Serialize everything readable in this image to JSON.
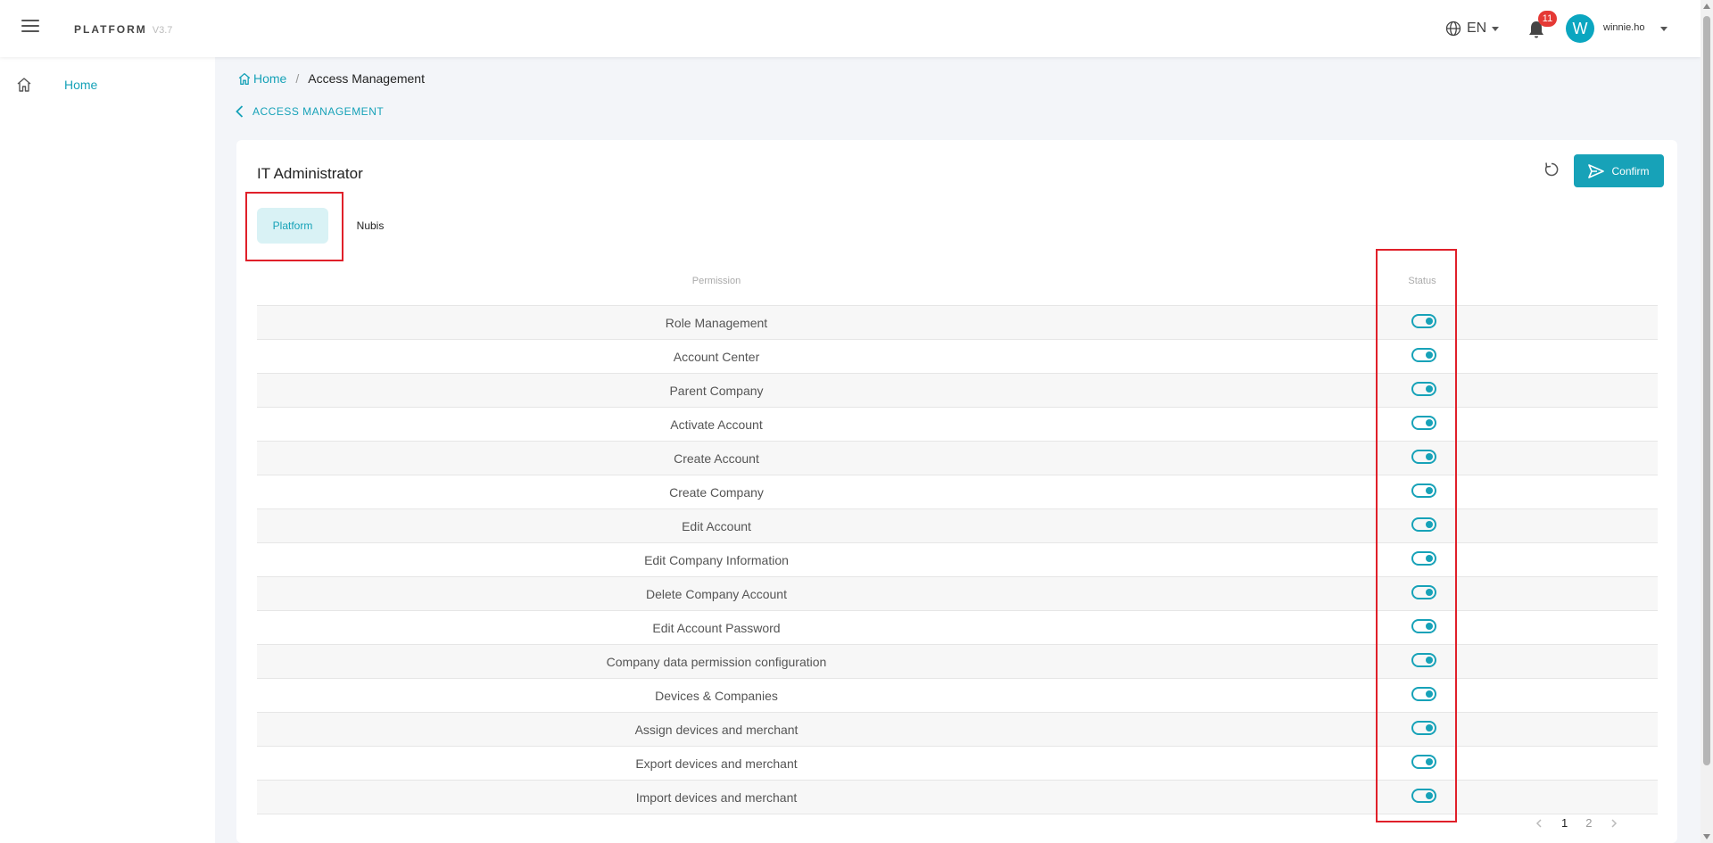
{
  "header": {
    "brand": "PLATFORM",
    "version": "V3.7",
    "language": "EN",
    "notification_count": "11",
    "avatar_initial": "W",
    "username": "winnie.ho"
  },
  "sidebar": {
    "items": [
      {
        "label": "Home",
        "icon": "home-icon"
      }
    ]
  },
  "breadcrumb": {
    "home": "Home",
    "separator": "/",
    "current": "Access Management"
  },
  "back_label": "ACCESS MANAGEMENT",
  "card": {
    "title": "IT Administrator",
    "confirm_label": "Confirm",
    "tabs": [
      "Platform",
      "Nubis"
    ],
    "active_tab": "Platform"
  },
  "table": {
    "headers": {
      "permission": "Permission",
      "status": "Status"
    },
    "rows": [
      {
        "permission": "Role Management",
        "enabled": true
      },
      {
        "permission": "Account Center",
        "enabled": true
      },
      {
        "permission": "Parent Company",
        "enabled": true
      },
      {
        "permission": "Activate Account",
        "enabled": true
      },
      {
        "permission": "Create Account",
        "enabled": true
      },
      {
        "permission": "Create Company",
        "enabled": true
      },
      {
        "permission": "Edit Account",
        "enabled": true
      },
      {
        "permission": "Edit Company Information",
        "enabled": true
      },
      {
        "permission": "Delete Company Account",
        "enabled": true
      },
      {
        "permission": "Edit Account Password",
        "enabled": true
      },
      {
        "permission": "Company data permission configuration",
        "enabled": true
      },
      {
        "permission": "Devices & Companies",
        "enabled": true
      },
      {
        "permission": "Assign devices and merchant",
        "enabled": true
      },
      {
        "permission": "Export devices and merchant",
        "enabled": true
      },
      {
        "permission": "Import devices and merchant",
        "enabled": true
      }
    ]
  },
  "pagination": {
    "pages": [
      "1",
      "2"
    ],
    "current": "1"
  },
  "colors": {
    "accent": "#17a2b8",
    "highlight": "#e0202a",
    "badge": "#e53935"
  }
}
